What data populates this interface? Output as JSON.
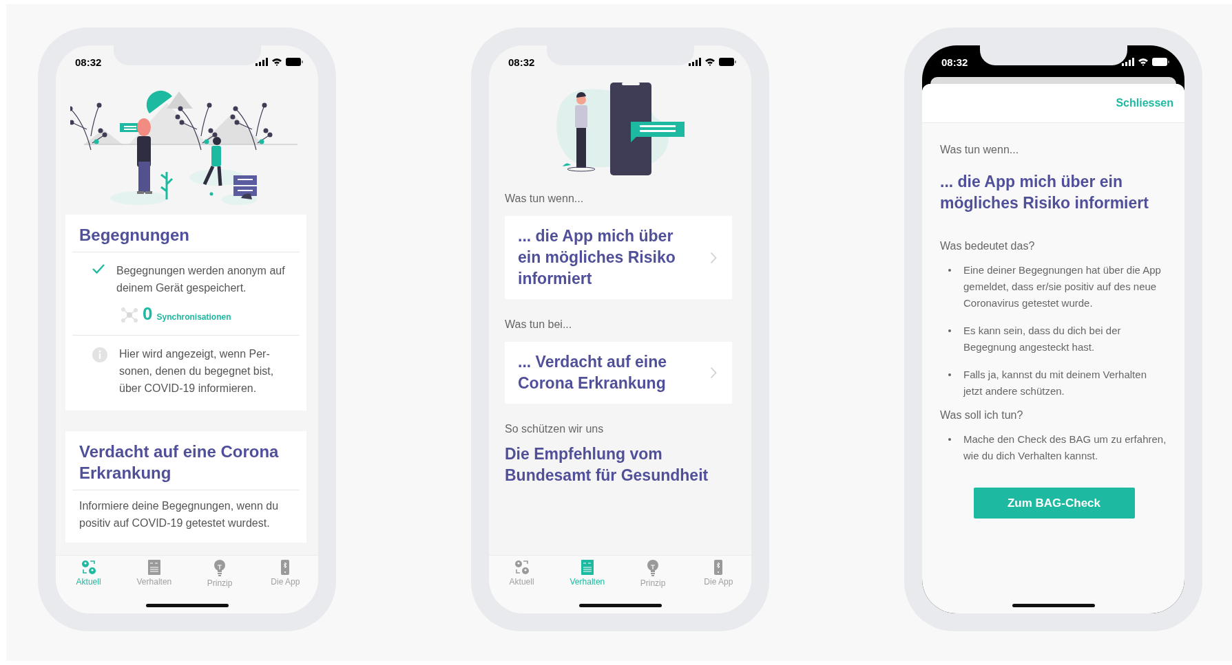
{
  "screens": [
    {
      "kind": "overview",
      "time": "08:32",
      "cards": [
        {
          "title": "Begegnungen",
          "rows": [
            {
              "kind": "check",
              "text": "Begegnungen werden anonym auf deinem Gerät gespeichert."
            },
            {
              "kind": "sync",
              "count": "0",
              "label": "Synchronisationen"
            },
            {
              "kind": "info",
              "text": "Hier wird angezeigt, wenn Per-sonen, denen du begegnet bist, über COVID-19 informieren."
            }
          ]
        },
        {
          "title": "Verdacht auf eine Corona Erkrankung",
          "rows": [
            {
              "kind": "plain",
              "text": "Informiere deine Begegnungen, wenn du positiv auf COVID-19 getestet wurdest."
            }
          ]
        }
      ],
      "tabs": [
        {
          "label": "Aktuell",
          "selected": true
        },
        {
          "label": "Verhalten",
          "selected": false
        },
        {
          "label": "Prinzip",
          "selected": false
        },
        {
          "label": "Die App",
          "selected": false
        }
      ]
    },
    {
      "kind": "behaviour",
      "time": "08:32",
      "sections": [
        {
          "kind": "link",
          "caption": "Was tun wenn...",
          "title": "... die App mich über ein mögliches Risiko informiert"
        },
        {
          "kind": "link",
          "caption": "Was tun bei...",
          "title": "... Verdacht auf eine Corona Erkrankung"
        },
        {
          "kind": "heading",
          "caption": "So schützen wir uns",
          "title": "Die Empfehlung vom Bundesamt für Gesundheit"
        }
      ],
      "tabs": [
        {
          "label": "Aktuell",
          "selected": false
        },
        {
          "label": "Verhalten",
          "selected": true
        },
        {
          "label": "Prinzip",
          "selected": false
        },
        {
          "label": "Die App",
          "selected": false
        }
      ]
    },
    {
      "kind": "detail",
      "time": "08:32",
      "close": "Schliessen",
      "caption": "Was tun wenn...",
      "title": "... die App mich über ein mögliches Risiko informiert",
      "groups": [
        {
          "heading": "Was bedeutet das?",
          "bullets": [
            "Eine deiner Begegnungen hat über die App gemeldet, dass er/sie positiv auf des neue Coronavirus getestet wurde.",
            "Es kann sein, dass du dich bei der Begegnung angesteckt hast.",
            "Falls ja, kannst du mit deinem Verhalten jetzt andere schützen."
          ]
        },
        {
          "heading": "Was soll ich tun?",
          "bullets": [
            "Mache den Check des BAG um zu erfahren, wie du dich Verhalten kannst."
          ]
        }
      ],
      "button": "Zum BAG-Check"
    }
  ]
}
